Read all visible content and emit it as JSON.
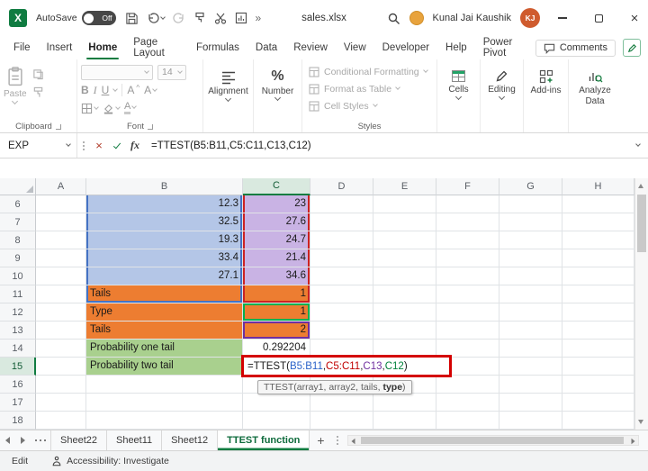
{
  "title_bar": {
    "autosave_label": "AutoSave",
    "autosave_state": "Off",
    "filename": "sales.xlsx",
    "user_name": "Kunal Jai Kaushik",
    "user_initials": "KJ"
  },
  "ribbon_tabs": {
    "items": [
      "File",
      "Insert",
      "Home",
      "Page Layout",
      "Formulas",
      "Data",
      "Review",
      "View",
      "Developer",
      "Help",
      "Power Pivot"
    ],
    "active": "Home",
    "comments_label": "Comments"
  },
  "ribbon": {
    "clipboard": {
      "paste_label": "Paste",
      "group_label": "Clipboard"
    },
    "font": {
      "group_label": "Font",
      "size_value": "14",
      "bold_label": "B",
      "italic_label": "I",
      "underline_label": "U"
    },
    "alignment": {
      "group_label": "Alignment"
    },
    "number": {
      "group_label": "Number",
      "percent_symbol": "%"
    },
    "styles": {
      "group_label": "Styles",
      "items": [
        "Conditional Formatting",
        "Format as Table",
        "Cell Styles"
      ]
    },
    "cells": {
      "group_label": "Cells"
    },
    "editing": {
      "group_label": "Editing"
    },
    "addins": {
      "group_label": "Add-ins"
    },
    "analyze": {
      "group_label": "Analyze Data"
    }
  },
  "formula_bar": {
    "name_box_value": "EXP",
    "formula": "=TTEST(B5:B11,C5:C11,C13,C12)"
  },
  "grid": {
    "column_headers": [
      "A",
      "B",
      "C",
      "D",
      "E",
      "F",
      "G",
      "H"
    ],
    "active_column": "C",
    "active_row": "15",
    "rows": [
      {
        "num": "6",
        "cells": {
          "B": {
            "text": "12.3",
            "bg": "fill_blue",
            "align": "right",
            "mq": {
              "c": "marquee_blue",
              "s": "lr"
            }
          },
          "C": {
            "text": "23",
            "bg": "fill_purple",
            "align": "right",
            "mq": {
              "c": "marquee_red",
              "s": "lr"
            }
          }
        }
      },
      {
        "num": "7",
        "cells": {
          "B": {
            "text": "32.5",
            "bg": "fill_blue",
            "align": "right",
            "mq": {
              "c": "marquee_blue",
              "s": "lr"
            }
          },
          "C": {
            "text": "27.6",
            "bg": "fill_purple",
            "align": "right",
            "mq": {
              "c": "marquee_red",
              "s": "lr"
            }
          }
        }
      },
      {
        "num": "8",
        "cells": {
          "B": {
            "text": "19.3",
            "bg": "fill_blue",
            "align": "right",
            "mq": {
              "c": "marquee_blue",
              "s": "lr"
            }
          },
          "C": {
            "text": "24.7",
            "bg": "fill_purple",
            "align": "right",
            "mq": {
              "c": "marquee_red",
              "s": "lr"
            }
          }
        }
      },
      {
        "num": "9",
        "cells": {
          "B": {
            "text": "33.4",
            "bg": "fill_blue",
            "align": "right",
            "mq": {
              "c": "marquee_blue",
              "s": "lr"
            }
          },
          "C": {
            "text": "21.4",
            "bg": "fill_purple",
            "align": "right",
            "mq": {
              "c": "marquee_red",
              "s": "lr"
            }
          }
        }
      },
      {
        "num": "10",
        "cells": {
          "B": {
            "text": "27.1",
            "bg": "fill_blue",
            "align": "right",
            "mq": {
              "c": "marquee_blue",
              "s": "lr"
            }
          },
          "C": {
            "text": "34.6",
            "bg": "fill_purple",
            "align": "right",
            "mq": {
              "c": "marquee_red",
              "s": "lr"
            }
          }
        }
      },
      {
        "num": "11",
        "cells": {
          "B": {
            "text": "Tails",
            "bg": "fill_orange",
            "align": "left",
            "mq": {
              "c": "marquee_blue",
              "s": "lrb"
            }
          },
          "C": {
            "text": "1",
            "bg": "fill_orange",
            "align": "right",
            "mq": {
              "c": "marquee_red",
              "s": "lrb"
            }
          }
        }
      },
      {
        "num": "12",
        "cells": {
          "B": {
            "text": "Type",
            "bg": "fill_orange",
            "align": "left"
          },
          "C": {
            "text": "1",
            "bg": "fill_orange",
            "align": "right",
            "mq": {
              "c": "marquee_green",
              "s": "all"
            }
          }
        }
      },
      {
        "num": "13",
        "cells": {
          "B": {
            "text": "Tails",
            "bg": "fill_orange",
            "align": "left"
          },
          "C": {
            "text": "2",
            "bg": "fill_orange",
            "align": "right",
            "mq": {
              "c": "marquee_purple",
              "s": "all"
            }
          }
        }
      },
      {
        "num": "14",
        "cells": {
          "B": {
            "text": "Probability one tail",
            "bg": "fill_green",
            "align": "left"
          },
          "C": {
            "text": "0.292204",
            "align": "right"
          }
        }
      },
      {
        "num": "15",
        "cells": {
          "B": {
            "text": "Probability two tail",
            "bg": "fill_green",
            "align": "left"
          }
        }
      },
      {
        "num": "16"
      },
      {
        "num": "17"
      },
      {
        "num": "18"
      }
    ],
    "formula_cell": {
      "row": "15",
      "column": "C",
      "parts": [
        {
          "t": "=TTEST(",
          "c": "#1a1a1a"
        },
        {
          "t": "B5:B11",
          "c": "#2a62c9"
        },
        {
          "t": ",",
          "c": "#1a1a1a"
        },
        {
          "t": "C5:C11",
          "c": "#c00000"
        },
        {
          "t": ",",
          "c": "#1a1a1a"
        },
        {
          "t": "C13",
          "c": "#7030a0"
        },
        {
          "t": ",",
          "c": "#1a1a1a"
        },
        {
          "t": "C12",
          "c": "#00823b"
        },
        {
          "t": ")",
          "c": "#1a1a1a"
        }
      ]
    },
    "tooltip_parts": [
      {
        "t": "TTEST(array1, array2, tails, ",
        "b": false
      },
      {
        "t": "type",
        "b": true
      },
      {
        "t": ")",
        "b": false
      }
    ]
  },
  "sheet_bar": {
    "tabs": [
      "Sheet22",
      "Sheet11",
      "Sheet12",
      "TTEST function"
    ],
    "active_tab": "TTEST function",
    "add_label": "+"
  },
  "status_bar": {
    "mode": "Edit",
    "accessibility_label": "Accessibility: Investigate"
  },
  "colors": {
    "accent_green": "#107c41",
    "fill_blue": "#b4c6e7",
    "fill_purple": "#c9b3e4",
    "fill_orange": "#ed7d31",
    "fill_green": "#a9d08e",
    "marquee_blue": "#4472c4",
    "marquee_red": "#cc2222",
    "marquee_green": "#00b050",
    "marquee_purple": "#7030a0",
    "annotation_red": "#d40000",
    "avatar_orange": "#cf5b2e",
    "badge_yellow": "#e8a33d"
  }
}
